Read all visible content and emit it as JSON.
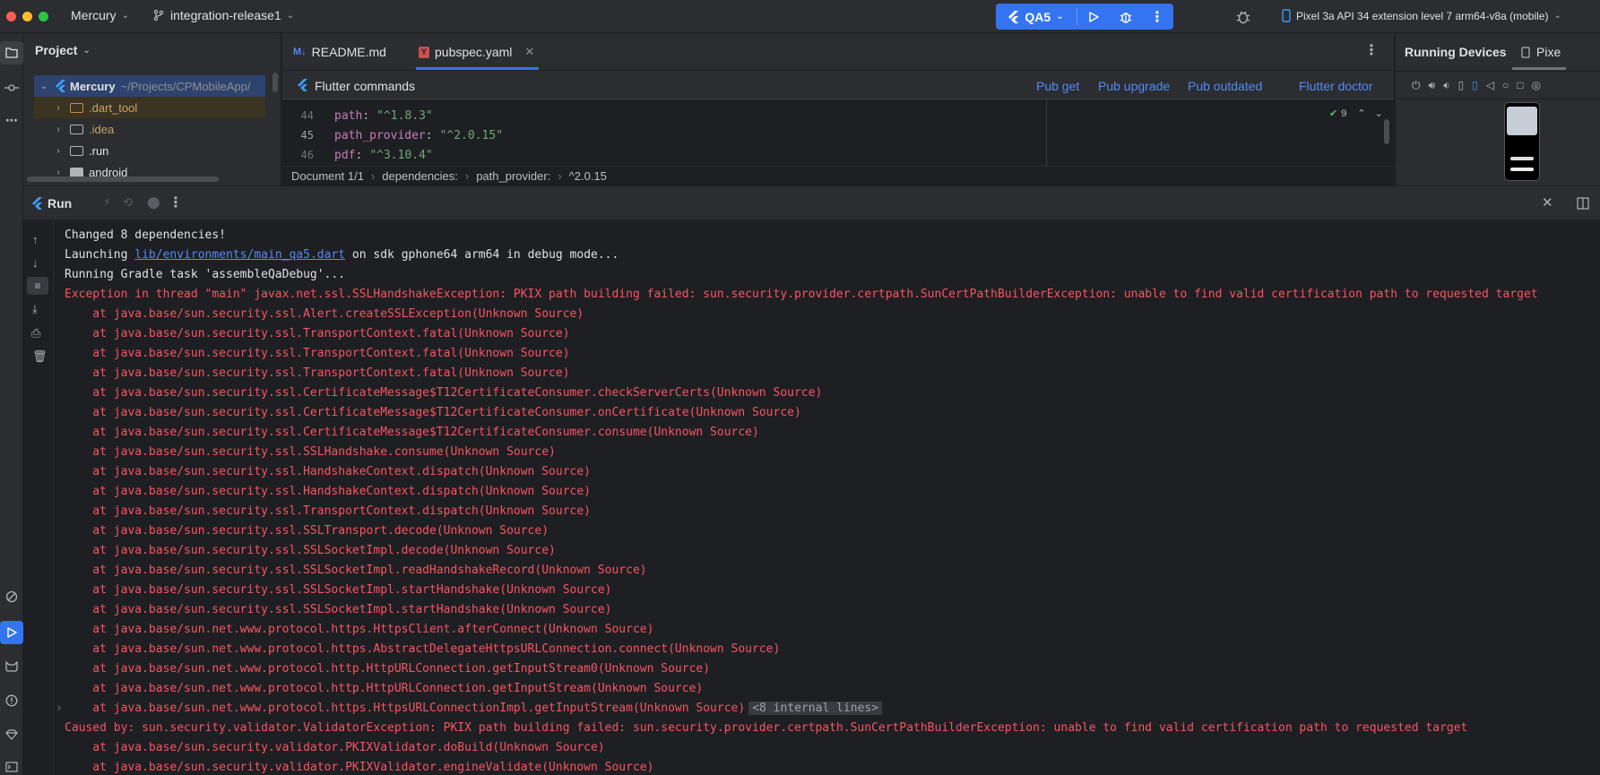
{
  "titlebar": {
    "project_name": "Mercury",
    "branch": "integration-release1",
    "run_config": "QA5",
    "device": "Pixel 3a API 34 extension level 7 arm64-v8a (mobile)"
  },
  "project_panel": {
    "title": "Project",
    "root_name": "Mercury",
    "root_path": "~/Projects/CPMobileApp/",
    "items": [
      {
        "label": ".dart_tool"
      },
      {
        "label": ".idea"
      },
      {
        "label": ".run"
      },
      {
        "label": "android"
      }
    ]
  },
  "editor": {
    "tabs": [
      {
        "label": "README.md",
        "icon": "M↓"
      },
      {
        "label": "pubspec.yaml",
        "icon": "Y"
      }
    ],
    "flutter_bar": {
      "title": "Flutter commands",
      "pub_get": "Pub get",
      "pub_upgrade": "Pub upgrade",
      "pub_outdated": "Pub outdated",
      "flutter_doctor": "Flutter doctor"
    },
    "problems_count": "9",
    "code_lines": [
      {
        "num": "44",
        "key": "path",
        "value": "\"^1.8.3\""
      },
      {
        "num": "45",
        "key": "path_provider",
        "value": "\"^2.0.15\""
      },
      {
        "num": "46",
        "key": "pdf",
        "value": "\"^3.10.4\""
      }
    ],
    "breadcrumbs": [
      "Document 1/1",
      "dependencies:",
      "path_provider:",
      "^2.0.15"
    ]
  },
  "devices_panel": {
    "title": "Running Devices",
    "tab_label": "Pixe"
  },
  "run_panel": {
    "title": "Run",
    "lines": [
      {
        "text": "Changed 8 dependencies!",
        "type": "normal"
      },
      {
        "prefix": "Launching ",
        "link": "lib/environments/main_qa5.dart",
        "suffix": " on sdk gphone64 arm64 in debug mode...",
        "type": "launch"
      },
      {
        "text": "Running Gradle task 'assembleQaDebug'...",
        "type": "normal"
      },
      {
        "text": "Exception in thread \"main\" javax.net.ssl.SSLHandshakeException: PKIX path building failed: sun.security.provider.certpath.SunCertPathBuilderException: unable to find valid certification path to requested target",
        "type": "err"
      },
      {
        "text": "    at java.base/sun.security.ssl.Alert.createSSLException(Unknown Source)",
        "type": "err"
      },
      {
        "text": "    at java.base/sun.security.ssl.TransportContext.fatal(Unknown Source)",
        "type": "err"
      },
      {
        "text": "    at java.base/sun.security.ssl.TransportContext.fatal(Unknown Source)",
        "type": "err"
      },
      {
        "text": "    at java.base/sun.security.ssl.TransportContext.fatal(Unknown Source)",
        "type": "err"
      },
      {
        "text": "    at java.base/sun.security.ssl.CertificateMessage$T12CertificateConsumer.checkServerCerts(Unknown Source)",
        "type": "err"
      },
      {
        "text": "    at java.base/sun.security.ssl.CertificateMessage$T12CertificateConsumer.onCertificate(Unknown Source)",
        "type": "err"
      },
      {
        "text": "    at java.base/sun.security.ssl.CertificateMessage$T12CertificateConsumer.consume(Unknown Source)",
        "type": "err"
      },
      {
        "text": "    at java.base/sun.security.ssl.SSLHandshake.consume(Unknown Source)",
        "type": "err"
      },
      {
        "text": "    at java.base/sun.security.ssl.HandshakeContext.dispatch(Unknown Source)",
        "type": "err"
      },
      {
        "text": "    at java.base/sun.security.ssl.HandshakeContext.dispatch(Unknown Source)",
        "type": "err"
      },
      {
        "text": "    at java.base/sun.security.ssl.TransportContext.dispatch(Unknown Source)",
        "type": "err"
      },
      {
        "text": "    at java.base/sun.security.ssl.SSLTransport.decode(Unknown Source)",
        "type": "err"
      },
      {
        "text": "    at java.base/sun.security.ssl.SSLSocketImpl.decode(Unknown Source)",
        "type": "err"
      },
      {
        "text": "    at java.base/sun.security.ssl.SSLSocketImpl.readHandshakeRecord(Unknown Source)",
        "type": "err"
      },
      {
        "text": "    at java.base/sun.security.ssl.SSLSocketImpl.startHandshake(Unknown Source)",
        "type": "err"
      },
      {
        "text": "    at java.base/sun.security.ssl.SSLSocketImpl.startHandshake(Unknown Source)",
        "type": "err"
      },
      {
        "text": "    at java.base/sun.net.www.protocol.https.HttpsClient.afterConnect(Unknown Source)",
        "type": "err"
      },
      {
        "text": "    at java.base/sun.net.www.protocol.https.AbstractDelegateHttpsURLConnection.connect(Unknown Source)",
        "type": "err"
      },
      {
        "text": "    at java.base/sun.net.www.protocol.http.HttpURLConnection.getInputStream0(Unknown Source)",
        "type": "err"
      },
      {
        "text": "    at java.base/sun.net.www.protocol.http.HttpURLConnection.getInputStream(Unknown Source)",
        "type": "err"
      },
      {
        "text": "    at java.base/sun.net.www.protocol.https.HttpsURLConnectionImpl.getInputStream(Unknown Source)",
        "type": "err",
        "fold": "<8 internal lines>"
      },
      {
        "text": "Caused by: sun.security.validator.ValidatorException: PKIX path building failed: sun.security.provider.certpath.SunCertPathBuilderException: unable to find valid certification path to requested target",
        "type": "err"
      },
      {
        "text": "    at java.base/sun.security.validator.PKIXValidator.doBuild(Unknown Source)",
        "type": "err"
      },
      {
        "text": "    at java.base/sun.security.validator.PKIXValidator.engineValidate(Unknown Source)",
        "type": "err"
      }
    ]
  },
  "colors": {
    "background": "#1e1f22",
    "panel": "#2b2d30",
    "accent": "#3574f0",
    "error": "#f75464",
    "link": "#548af7"
  }
}
